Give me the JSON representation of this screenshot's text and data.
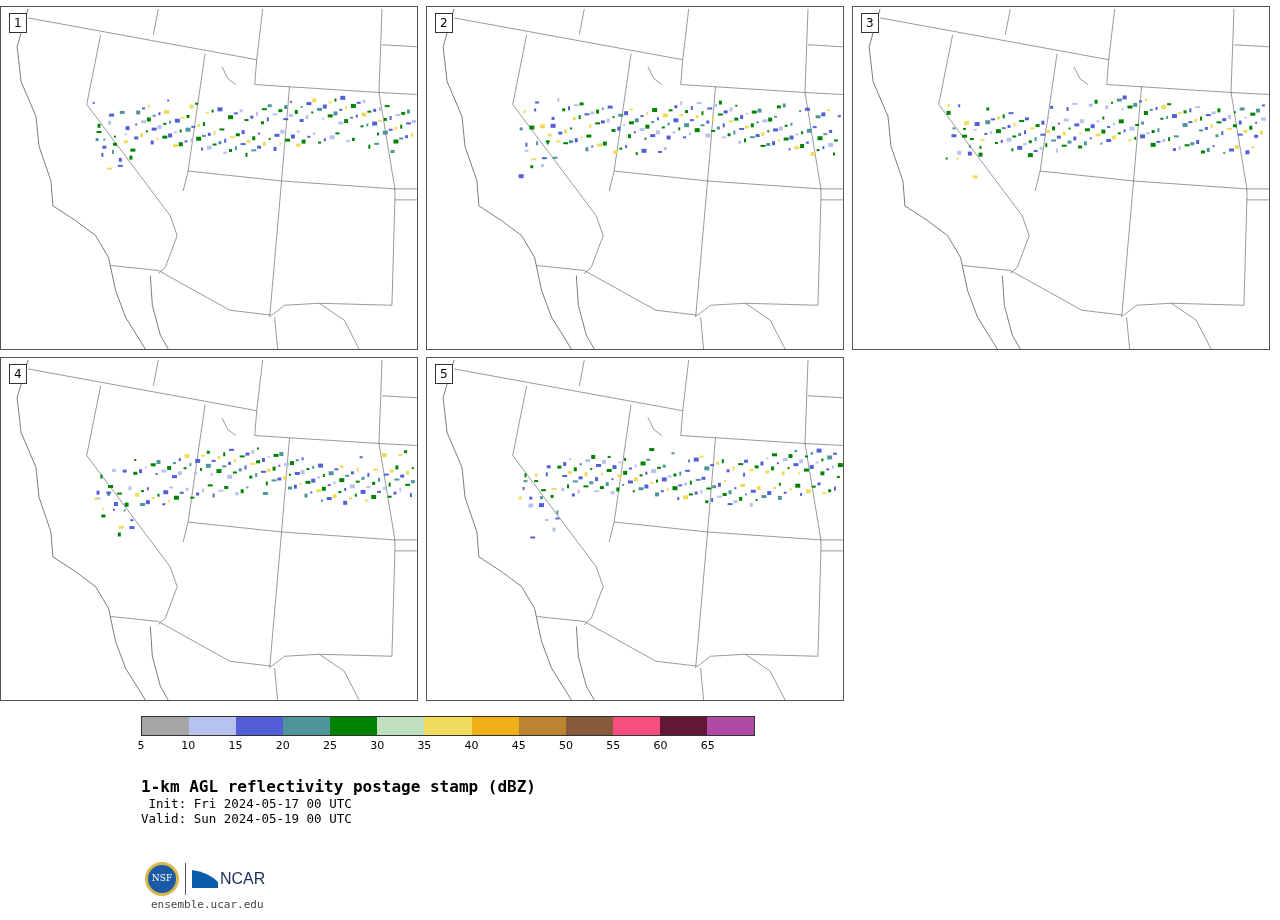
{
  "panels": [
    {
      "label": "1"
    },
    {
      "label": "2"
    },
    {
      "label": "3"
    },
    {
      "label": "4"
    },
    {
      "label": "5"
    }
  ],
  "colorbar": {
    "bins": [
      {
        "color": "#a5a5a5"
      },
      {
        "color": "#b8c2ee"
      },
      {
        "color": "#525fd6"
      },
      {
        "color": "#4f949b"
      },
      {
        "color": "#008200"
      },
      {
        "color": "#c0dfc0"
      },
      {
        "color": "#f0dc5c"
      },
      {
        "color": "#eeaf17"
      },
      {
        "color": "#bc8330"
      },
      {
        "color": "#885a3c"
      },
      {
        "color": "#f54f7f"
      },
      {
        "color": "#621736"
      },
      {
        "color": "#ac4aa4"
      }
    ],
    "ticks": [
      "5",
      "10",
      "15",
      "20",
      "25",
      "30",
      "35",
      "40",
      "45",
      "50",
      "55",
      "60",
      "65"
    ]
  },
  "title": "1-km AGL reflectivity postage stamp (dBZ)",
  "init": " Init: Fri 2024-05-17 00 UTC",
  "valid": "Valid: Sun 2024-05-19 00 UTC",
  "logo": {
    "nsf": "NSF",
    "ncar": "NCAR"
  },
  "url": "ensemble.ucar.edu"
}
